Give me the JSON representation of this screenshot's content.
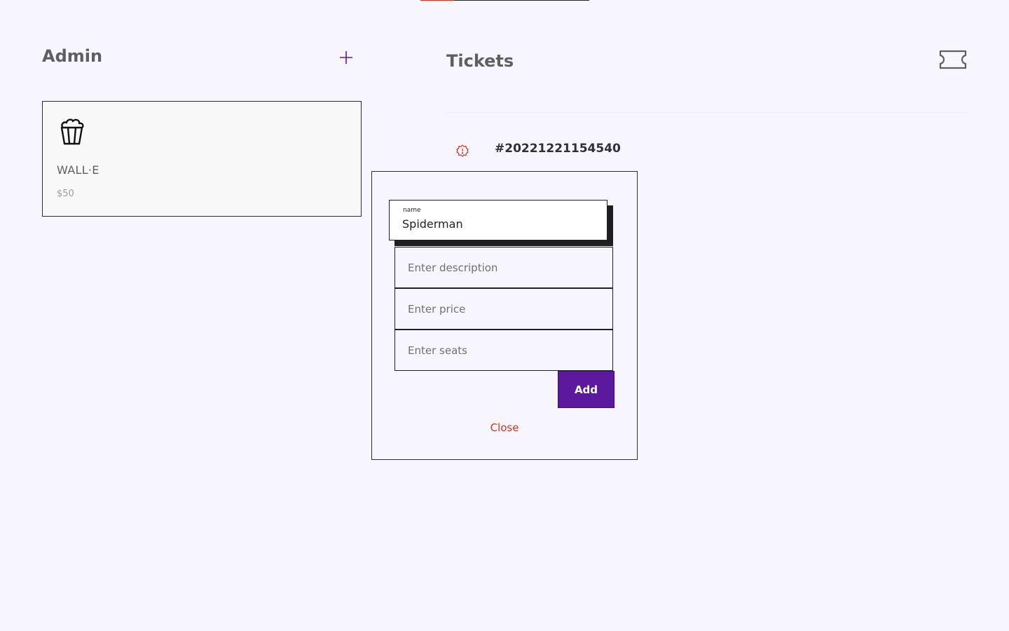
{
  "top_progress": {
    "fraction": 0.2
  },
  "admin": {
    "title": "Admin",
    "add_icon": "plus-icon",
    "movie_card": {
      "icon": "popcorn-icon",
      "name": "WALL·E",
      "price": "$50"
    }
  },
  "tickets": {
    "title": "Tickets",
    "icon": "ticket-icon",
    "items": [
      {
        "status_icon": "warning-badge-icon",
        "status_color": "#e0301e",
        "number": "#20221221154540"
      }
    ]
  },
  "modal": {
    "name_field": {
      "label": "name",
      "value": "Spiderman"
    },
    "description_field": {
      "placeholder": "Enter description",
      "value": ""
    },
    "price_field": {
      "placeholder": "Enter price",
      "value": ""
    },
    "seats_field": {
      "placeholder": "Enter seats",
      "value": ""
    },
    "add_label": "Add",
    "close_label": "Close"
  },
  "colors": {
    "accent": "#5b1a9e",
    "danger": "#d93418",
    "background": "#f7f5fe"
  }
}
